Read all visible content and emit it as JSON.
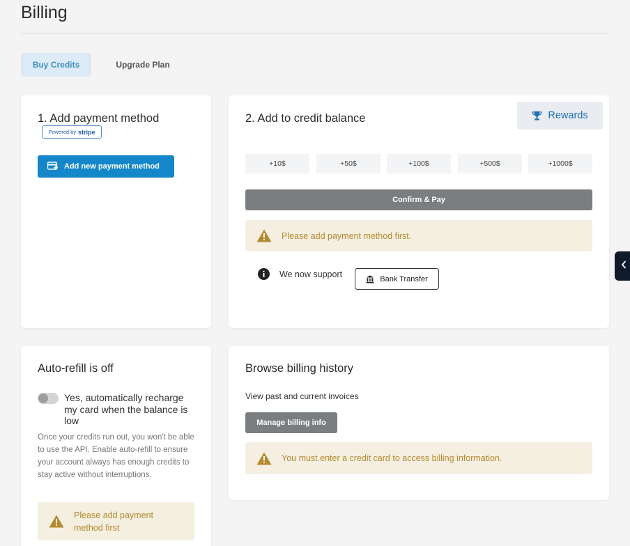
{
  "page": {
    "title": "Billing"
  },
  "tabs": [
    {
      "label": "Buy Credits",
      "active": true
    },
    {
      "label": "Upgrade Plan",
      "active": false
    }
  ],
  "payment_card": {
    "title": "1. Add payment method",
    "stripe_badge_prefix": "Powered by",
    "stripe_badge_brand": "stripe",
    "add_button": "Add new payment method",
    "add_button_icon": "card-plus-icon"
  },
  "credit_card": {
    "title": "2. Add to credit balance",
    "rewards_label": "Rewards",
    "rewards_icon": "trophy-icon",
    "amounts": [
      "+10$",
      "+50$",
      "+100$",
      "+500$",
      "+1000$"
    ],
    "confirm_label": "Confirm & Pay",
    "warning": "Please add payment method first.",
    "support_text": "We now support",
    "bank_button": "Bank Transfer",
    "bank_icon": "bank-icon"
  },
  "refill_card": {
    "title": "Auto-refill is off",
    "toggle_on": false,
    "toggle_label": "Yes, automatically recharge my card when the balance is low",
    "description": "Once your credits run out, you won't be able to use the API. Enable auto-refill to ensure your account always has enough credits to stay active without interruptions.",
    "warning": "Please add payment method first"
  },
  "history_card": {
    "title": "Browse billing history",
    "subtitle": "View past and current invoices",
    "manage_button": "Manage billing info",
    "warning": "You must enter a credit card to access billing information."
  },
  "colors": {
    "primary": "#1387c9",
    "tab_active_bg": "#dcebf5",
    "warning_bg": "#f4efe1",
    "warning_text": "#b48a2c",
    "disabled_button": "#7b7e81"
  }
}
